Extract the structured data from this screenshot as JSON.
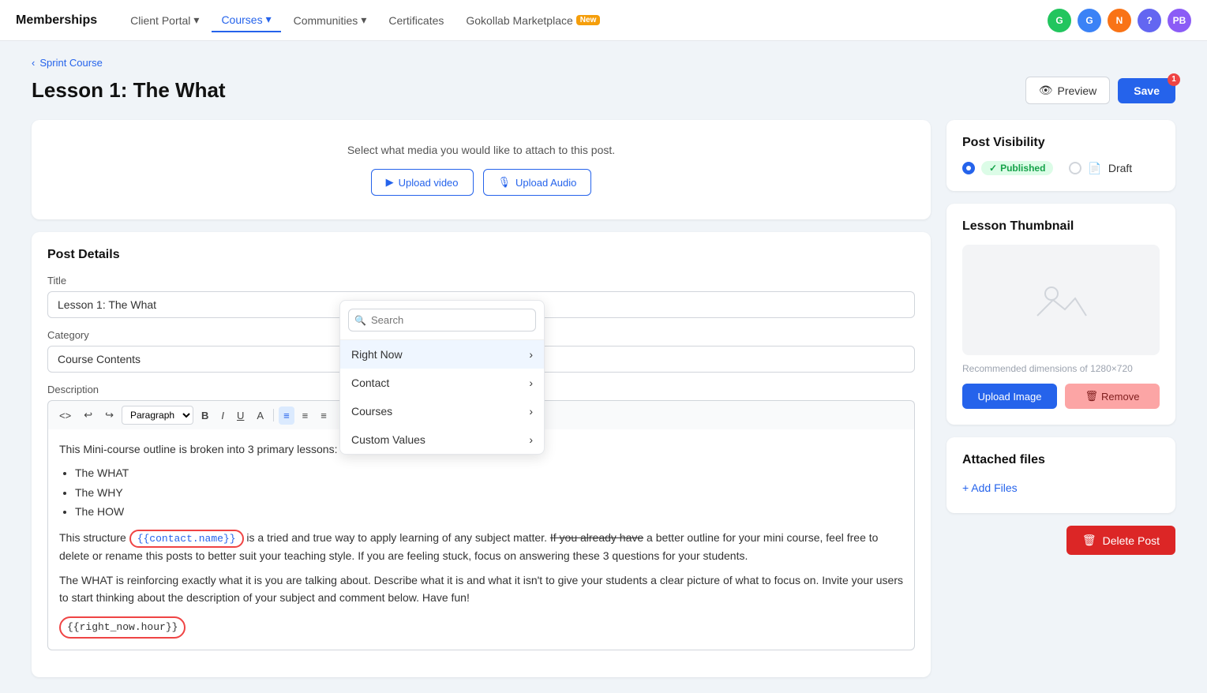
{
  "nav": {
    "brand": "Memberships",
    "items": [
      {
        "label": "Client Portal",
        "hasDropdown": true,
        "active": false
      },
      {
        "label": "Courses",
        "hasDropdown": true,
        "active": true
      },
      {
        "label": "Communities",
        "hasDropdown": true,
        "active": false
      },
      {
        "label": "Certificates",
        "hasDropdown": false,
        "active": false
      },
      {
        "label": "Gokollab Marketplace",
        "hasDropdown": false,
        "active": false,
        "badge": "New"
      }
    ],
    "avatars": [
      {
        "color": "#22c55e",
        "initials": "G"
      },
      {
        "color": "#3b82f6",
        "initials": "G"
      },
      {
        "color": "#f97316",
        "initials": "N"
      },
      {
        "color": "#6366f1",
        "initials": "?"
      },
      {
        "color": "#8b5cf6",
        "initials": "PB"
      }
    ]
  },
  "breadcrumb": {
    "label": "Sprint Course",
    "icon": "‹"
  },
  "page": {
    "title": "Lesson 1: The What"
  },
  "buttons": {
    "preview": "Preview",
    "save": "Save",
    "upload_video": "Upload video",
    "upload_audio": "Upload Audio",
    "upload_image": "Upload Image",
    "remove": "Remove",
    "add_files": "+ Add Files",
    "delete_post": "Delete Post"
  },
  "media_card": {
    "title": "Select what media you would like to attach to this post."
  },
  "post_details": {
    "title": "Post Details",
    "title_label": "Title",
    "title_value": "Lesson 1: The What",
    "category_label": "Category",
    "category_value": "Course Contents",
    "description_label": "Description"
  },
  "editor": {
    "toolbar": {
      "paragraph_select": "Paragraph",
      "buttons": [
        "<>",
        "↩",
        "↪",
        "B",
        "I",
        "U",
        "A",
        "≡",
        "≡",
        "≡",
        "≡",
        "≡",
        "≡",
        "✦",
        "⊞",
        "⊕",
        "◎"
      ]
    },
    "content": {
      "intro": "This Mini-course outline is broken into 3 primary lessons:",
      "list": [
        "The WHAT",
        "The WHY",
        "The HOW"
      ],
      "para1_start": "This structure ",
      "para1_tag": "{{contact.name}}",
      "para1_mid": " is a tried and true way to apply learning of any subject matter.",
      "para1_strikethrough": "If you already have",
      "para1_end": " a better outline for your mini course, feel free to delete or rename this posts to better suit your teaching style. If you are feeling stuck, focus on answering these 3 questions for your students.",
      "para2": "The WHAT is reinforcing exactly what it is you are talking about. Describe what it is and what it isn't to give your students a clear picture of what to focus on. Invite your users to start thinking about the description of your subject and comment below. Have fun!",
      "variable": "{{right_now.hour}}"
    }
  },
  "dropdown": {
    "search_placeholder": "Search",
    "items": [
      {
        "label": "Right Now",
        "hasArrow": true
      },
      {
        "label": "Contact",
        "hasArrow": true
      },
      {
        "label": "Courses",
        "hasArrow": true
      },
      {
        "label": "Custom Values",
        "hasArrow": true
      }
    ]
  },
  "sidebar": {
    "post_visibility": {
      "title": "Post Visibility",
      "options": [
        {
          "label": "Published",
          "selected": true,
          "badge": "Published"
        },
        {
          "label": "Draft",
          "selected": false
        }
      ]
    },
    "lesson_thumbnail": {
      "title": "Lesson Thumbnail",
      "dims_text": "Recommended dimensions of 1280×720"
    },
    "attached_files": {
      "title": "Attached files"
    }
  }
}
